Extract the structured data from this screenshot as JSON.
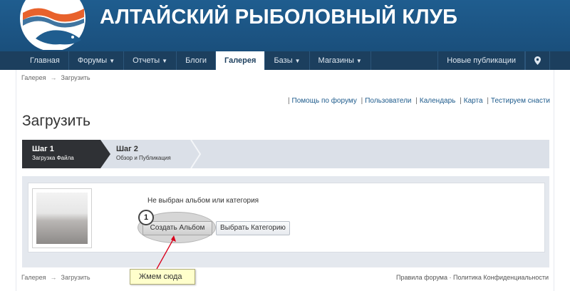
{
  "header": {
    "site_title": "АЛТАЙСКИЙ РЫБОЛОВНЫЙ КЛУБ",
    "brand_color": "#1f5d8f"
  },
  "nav": {
    "items": [
      {
        "label": "Главная",
        "dropdown": false
      },
      {
        "label": "Форумы",
        "dropdown": true
      },
      {
        "label": "Отчеты",
        "dropdown": true
      },
      {
        "label": "Блоги",
        "dropdown": false
      },
      {
        "label": "Галерея",
        "dropdown": false,
        "active": true
      },
      {
        "label": "Базы",
        "dropdown": true
      },
      {
        "label": "Магазины",
        "dropdown": true
      }
    ],
    "right_label": "Новые публикации",
    "location_icon": "map-pin-icon"
  },
  "breadcrumb": {
    "items": [
      "Галерея",
      "Загрузить"
    ],
    "separator": "→"
  },
  "top_links": [
    "Помощь по форуму",
    "Пользователи",
    "Календарь",
    "Карта",
    "Тестируем снасти"
  ],
  "page_title": "Загрузить",
  "steps": [
    {
      "title": "Шаг 1",
      "subtitle": "Загрузка Файла",
      "active": true
    },
    {
      "title": "Шаг 2",
      "subtitle": "Обзор и Публикация",
      "active": false
    }
  ],
  "upload": {
    "no_album_text": "Не выбран альбом или категория",
    "create_album_label": "Создать Альбом",
    "choose_category_label": "Выбрать Категорию"
  },
  "annotation": {
    "badge_number": "1",
    "callout_text": "Жмем сюда",
    "arrow_color": "#d9001b"
  },
  "footer": {
    "links": [
      "Правила форума",
      "Политика Конфиденциальности"
    ],
    "separator": "·"
  }
}
